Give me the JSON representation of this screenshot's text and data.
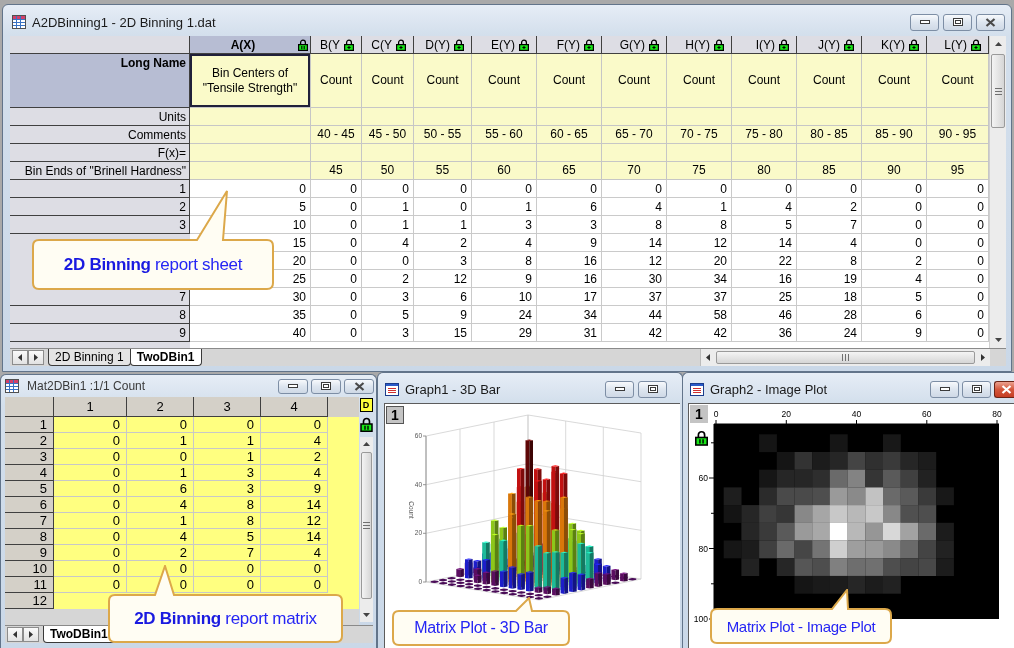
{
  "worksheet_window": {
    "title": "A2DBinning1 - 2D Binning 1.dat",
    "active": false,
    "columns": [
      {
        "header": "A(X)",
        "kind": "x",
        "selected": true
      },
      {
        "header": "B(Y",
        "kind": "y",
        "selected": false
      },
      {
        "header": "C(Y",
        "kind": "y",
        "selected": false
      },
      {
        "header": "D(Y)",
        "kind": "y",
        "selected": false
      },
      {
        "header": "E(Y)",
        "kind": "y",
        "selected": false
      },
      {
        "header": "F(Y)",
        "kind": "y",
        "selected": false
      },
      {
        "header": "G(Y)",
        "kind": "y",
        "selected": false
      },
      {
        "header": "H(Y)",
        "kind": "y",
        "selected": false
      },
      {
        "header": "I(Y)",
        "kind": "y",
        "selected": false
      },
      {
        "header": "J(Y)",
        "kind": "y",
        "selected": false
      },
      {
        "header": "K(Y)",
        "kind": "y",
        "selected": false
      },
      {
        "header": "L(Y)",
        "kind": "y",
        "selected": false
      }
    ],
    "label_rows": [
      {
        "label": "Long Name",
        "selected": true,
        "cells": [
          "Bin Centers of \"Tensile Strength\"",
          "Count",
          "Count",
          "Count",
          "Count",
          "Count",
          "Count",
          "Count",
          "Count",
          "Count",
          "Count",
          "Count"
        ]
      },
      {
        "label": "Units",
        "selected": false
      },
      {
        "label": "Comments",
        "selected": false,
        "cells": [
          null,
          "40 - 45",
          "45 - 50",
          "50 - 55",
          "55 - 60",
          "60 - 65",
          "65 - 70",
          "70 - 75",
          "75 - 80",
          "80 - 85",
          "85 - 90",
          "90 - 95"
        ]
      },
      {
        "label": "F(x)=",
        "selected": false
      },
      {
        "label": "Bin Ends of \"Brinell Hardness\"",
        "selected": false,
        "cells": [
          null,
          "45",
          "50",
          "55",
          "60",
          "65",
          "70",
          "75",
          "80",
          "85",
          "90",
          "95"
        ]
      }
    ],
    "rows": [
      {
        "header": "1",
        "cells": [
          "0",
          "0",
          "0",
          "0",
          "0",
          "0",
          "0",
          "0",
          "0",
          "0",
          "0",
          "0"
        ]
      },
      {
        "header": "2",
        "cells": [
          "5",
          "0",
          "1",
          "0",
          "1",
          "6",
          "4",
          "1",
          "4",
          "2",
          "0",
          "0"
        ]
      },
      {
        "header": "3",
        "cells": [
          "10",
          "0",
          "1",
          "1",
          "3",
          "3",
          "8",
          "8",
          "5",
          "7",
          "0",
          "0"
        ]
      },
      {
        "cells": [
          "15",
          "0",
          "4",
          "2",
          "4",
          "9",
          "14",
          "12",
          "14",
          "4",
          "0",
          "0"
        ]
      },
      {
        "cells": [
          "20",
          "0",
          "0",
          "3",
          "8",
          "16",
          "12",
          "20",
          "22",
          "8",
          "2",
          "0"
        ]
      },
      {
        "cells": [
          "25",
          "0",
          "2",
          "12",
          "9",
          "16",
          "30",
          "34",
          "16",
          "19",
          "4",
          "0"
        ]
      },
      {
        "header": "7",
        "cells": [
          "30",
          "0",
          "3",
          "6",
          "10",
          "17",
          "37",
          "37",
          "25",
          "18",
          "5",
          "0"
        ]
      },
      {
        "header": "8",
        "cells": [
          "35",
          "0",
          "5",
          "9",
          "24",
          "34",
          "44",
          "58",
          "46",
          "28",
          "6",
          "0"
        ]
      },
      {
        "header": "9",
        "cells": [
          "40",
          "0",
          "3",
          "15",
          "29",
          "31",
          "42",
          "42",
          "36",
          "24",
          "9",
          "0"
        ]
      }
    ],
    "sheet_tabs": [
      {
        "label": "2D Binning 1",
        "selected": false
      },
      {
        "label": "TwoDBin1",
        "selected": true
      }
    ],
    "callout": {
      "text": "**2D Binning** report sheet"
    }
  },
  "matrix_window": {
    "title": "Mat2DBin1 :1/1 Count",
    "active": false,
    "columns": [
      "1",
      "2",
      "3",
      "4"
    ],
    "corner_button": "D",
    "rows": [
      {
        "header": "1",
        "cells": [
          "0",
          "0",
          "0",
          "0"
        ]
      },
      {
        "header": "2",
        "cells": [
          "0",
          "1",
          "1",
          "4"
        ]
      },
      {
        "header": "3",
        "cells": [
          "0",
          "0",
          "1",
          "2"
        ]
      },
      {
        "header": "4",
        "cells": [
          "0",
          "1",
          "3",
          "4"
        ]
      },
      {
        "header": "5",
        "cells": [
          "0",
          "6",
          "3",
          "9"
        ]
      },
      {
        "header": "6",
        "cells": [
          "0",
          "4",
          "8",
          "14"
        ]
      },
      {
        "header": "7",
        "cells": [
          "0",
          "1",
          "8",
          "12"
        ]
      },
      {
        "header": "8",
        "cells": [
          "0",
          "4",
          "5",
          "14"
        ]
      },
      {
        "header": "9",
        "cells": [
          "0",
          "2",
          "7",
          "4"
        ]
      },
      {
        "header": "10",
        "cells": [
          "0",
          "0",
          "0",
          "0"
        ]
      },
      {
        "header": "11",
        "cells": [
          "0",
          "0",
          "0",
          "0"
        ]
      },
      {
        "header": "12"
      }
    ],
    "sheet_tabs": [
      {
        "label": "TwoDBin1",
        "selected": true
      }
    ],
    "callout": {
      "text": "**2D Binning** report matrix"
    }
  },
  "bar_graph_window": {
    "title": "Graph1 - 3D Bar",
    "layer": "1",
    "z_axis_title": "Count",
    "z_ticks": [
      "60",
      "40",
      "20",
      "0"
    ],
    "callout": {
      "text": "Matrix Plot - 3D Bar"
    }
  },
  "image_graph_window": {
    "title": "Graph2 - Image Plot",
    "active": true,
    "layer": "1",
    "x_ticks": [
      "0",
      "20",
      "40",
      "60",
      "80"
    ],
    "y_ticks": [
      "60",
      "80",
      "100"
    ],
    "callout": {
      "text": "Matrix Plot - Image Plot"
    }
  }
}
